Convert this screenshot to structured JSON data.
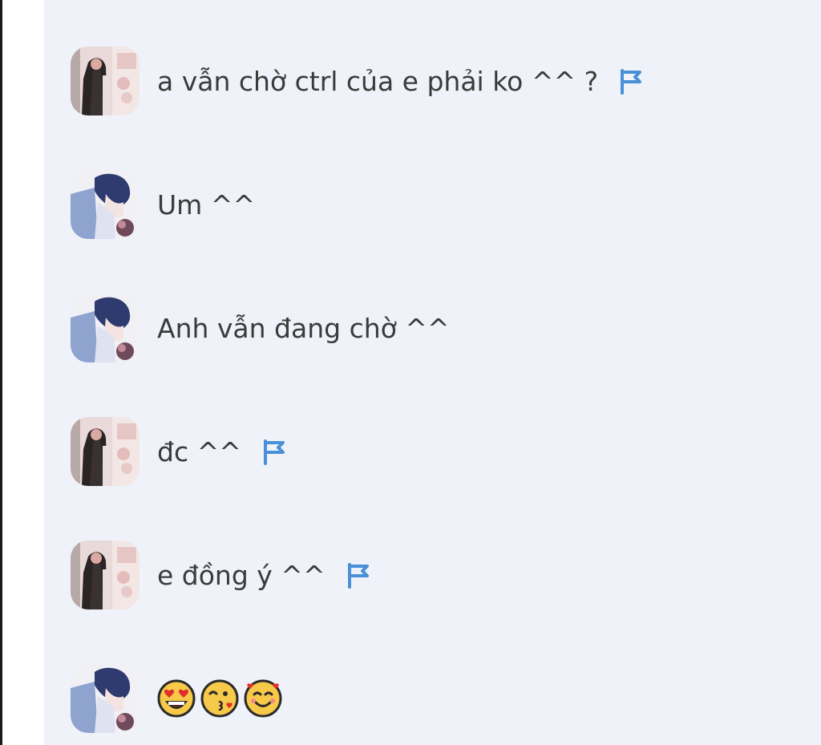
{
  "colors": {
    "panel_background": "#eff2f8",
    "text": "#3b3b3b",
    "flag": "#4a90d9"
  },
  "messages": [
    {
      "avatar": "girl-avatar",
      "text": "a vẫn chờ ctrl của e phải ko ^^ ?",
      "flag": true
    },
    {
      "avatar": "boy-avatar",
      "text": "Um ^^",
      "flag": false
    },
    {
      "avatar": "boy-avatar",
      "text": "Anh vẫn đang chờ ^^",
      "flag": false
    },
    {
      "avatar": "girl-avatar",
      "text": "đc ^^",
      "flag": true
    },
    {
      "avatar": "girl-avatar",
      "text": "e đồng ý ^^",
      "flag": true
    },
    {
      "avatar": "boy-avatar",
      "emojis": [
        "heart-eyes-emoji",
        "kissing-wink-emoji",
        "smiling-hearts-emoji"
      ],
      "flag": false
    }
  ]
}
